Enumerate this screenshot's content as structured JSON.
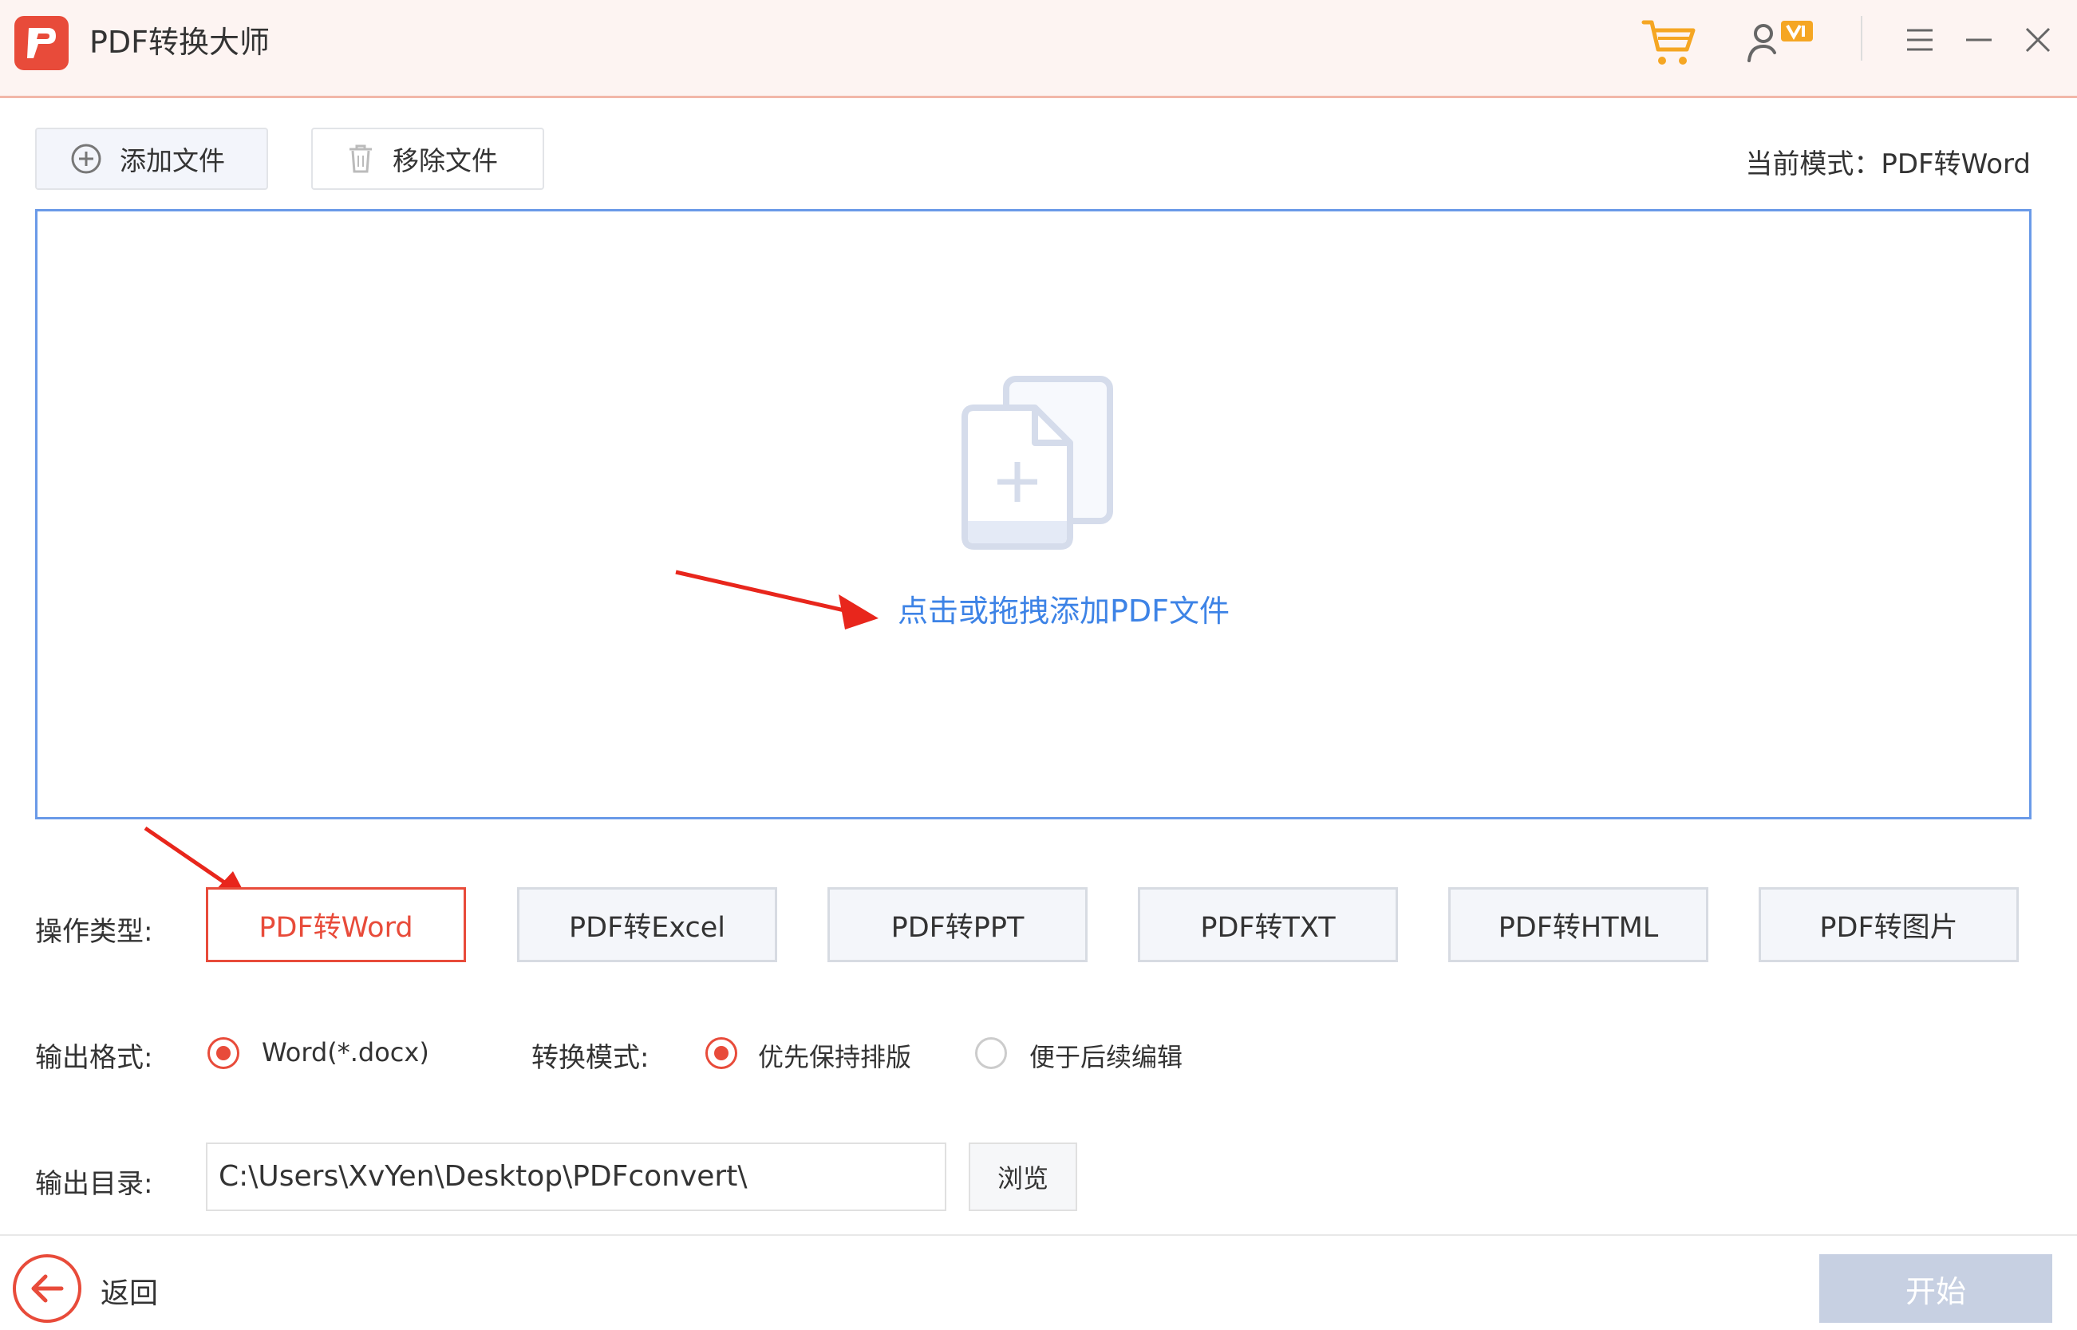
{
  "app": {
    "title": "PDF转换大师",
    "logo_icon": "pdf-logo-icon"
  },
  "titlebar_icons": [
    "cart-icon",
    "vip-user-icon",
    "menu-icon",
    "minimize-icon",
    "close-icon"
  ],
  "toolbar": {
    "add_label": "添加文件",
    "remove_label": "移除文件",
    "mode_label": "当前模式：PDF转Word"
  },
  "dropzone": {
    "hint": "点击或拖拽添加PDF文件",
    "icon": "add-file-icon"
  },
  "operation": {
    "label": "操作类型:",
    "types": [
      "PDF转Word",
      "PDF转Excel",
      "PDF转PPT",
      "PDF转TXT",
      "PDF转HTML",
      "PDF转图片"
    ],
    "selected": "PDF转Word"
  },
  "output_format": {
    "label": "输出格式:",
    "option": "Word(*.docx)"
  },
  "convert_mode": {
    "label": "转换模式:",
    "options": [
      "优先保持排版",
      "便于后续编辑"
    ],
    "selected": "优先保持排版"
  },
  "output_dir": {
    "label": "输出目录:",
    "value": "C:\\Users\\XvYen\\Desktop\\PDFconvert\\",
    "browse_label": "浏览"
  },
  "footer": {
    "back_label": "返回",
    "start_label": "开始"
  },
  "colors": {
    "accent": "#e84b3a",
    "link": "#3d83e6",
    "border_blue": "#6a9ae8",
    "start_disabled": "#c7d0e2"
  }
}
